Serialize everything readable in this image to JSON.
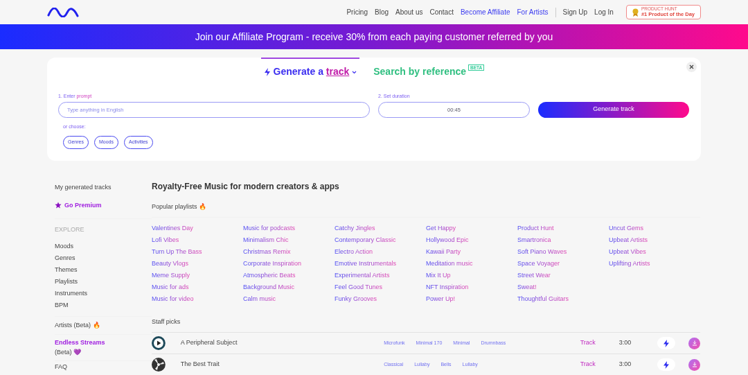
{
  "nav": {
    "links": [
      {
        "label": "Pricing",
        "kind": "plain"
      },
      {
        "label": "Blog",
        "kind": "plain"
      },
      {
        "label": "About us",
        "kind": "plain"
      },
      {
        "label": "Contact",
        "kind": "plain"
      },
      {
        "label": "Become Affiliate",
        "kind": "accent"
      },
      {
        "label": "For Artists",
        "kind": "accent"
      }
    ],
    "auth": [
      "Sign Up",
      "Log In"
    ],
    "badge": {
      "small": "PRODUCT HUNT",
      "title": "#1 Product of the Day"
    }
  },
  "banner": "Join our Affiliate Program - receive 30% from each paying customer referred by you",
  "generator": {
    "tabs": [
      {
        "label": "Generate a",
        "accent": "track",
        "selected": true
      },
      {
        "label": "Search by reference",
        "tag": "BETA",
        "selected": false
      }
    ],
    "prompt": {
      "label": "1. Enter ",
      "label_accent": "prompt",
      "placeholder": "Type anything in English"
    },
    "duration": {
      "label": "2. Set duration",
      "value": "00:45"
    },
    "button": "Generate track",
    "or_choose": "or choose:",
    "chips": [
      "Genres",
      "Moods",
      "Activities"
    ]
  },
  "sidebar": {
    "top": [
      {
        "label": "My generated tracks",
        "kind": "plain"
      },
      {
        "label": "Go Premium",
        "kind": "premium"
      }
    ],
    "section": "EXPLORE",
    "explore": [
      "Moods",
      "Genres",
      "Themes",
      "Playlists",
      "Instruments",
      "BPM"
    ],
    "artists": "Artists (Beta) 🔥",
    "streams": {
      "title": "Endless Streams",
      "sub": "(Beta) 💜"
    },
    "faq": "FAQ"
  },
  "main": {
    "title": "Royalty-Free Music for modern creators & apps",
    "popular": "Popular playlists 🔥",
    "playlists": [
      [
        "Valentines Day",
        "Lofi Vibes",
        "Turn Up The Bass",
        "Beauty Vlogs",
        "Meme Supply",
        "Music for ads",
        "Music for video"
      ],
      [
        "Music for podcasts",
        "Minimalism Chic",
        "Christmas Remix",
        "Corporate Inspiration",
        "Atmospheric Beats",
        "Background Music",
        "Calm music"
      ],
      [
        "Catchy Jingles",
        "Contemporary Classic",
        "Electro Action",
        "Emotive Instrumentals",
        "Experimental Artists",
        "Feel Good Tunes",
        "Funky Grooves"
      ],
      [
        "Get Happy",
        "Hollywood Epic",
        "Kawaii Party",
        "Meditation music",
        "Mix It Up",
        "NFT Inspiration",
        "Power Up!"
      ],
      [
        "Product Hunt",
        "Smartronica",
        "Soft Piano Waves",
        "Space Voyager",
        "Street Wear",
        "Sweat!",
        "Thoughtful Guitars"
      ],
      [
        "Uncut Gems",
        "Upbeat Artists",
        "Upbeat Vibes",
        "Uplifting Artists"
      ]
    ],
    "staff": "Staff picks",
    "tracks": [
      {
        "title": "A Peripheral Subject",
        "tags": [
          "Microfunk",
          "Minimal 170",
          "Minimal",
          "Drumnbass"
        ],
        "link": "Track",
        "duration": "3:00",
        "kind": "play"
      },
      {
        "title": "The Best Trait",
        "tags": [
          "Classical",
          "Lullaby",
          "Bells",
          "Lullaby"
        ],
        "link": "Track",
        "duration": "3:00",
        "kind": "cover"
      }
    ]
  }
}
